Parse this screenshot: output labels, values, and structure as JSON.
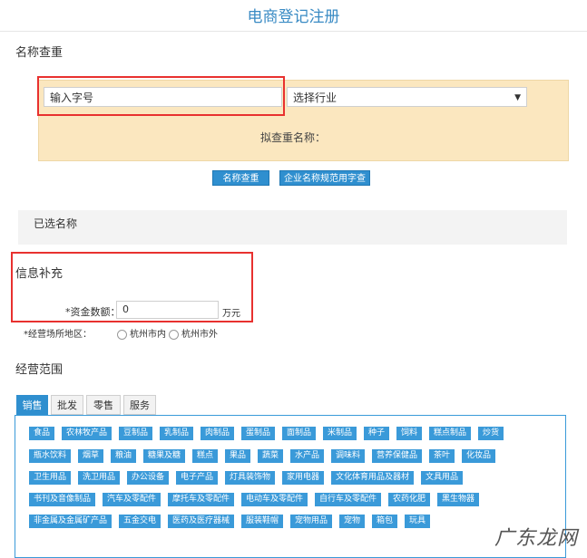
{
  "page": {
    "title": "电商登记注册"
  },
  "name_check": {
    "section_label": "名称查重",
    "input_placeholder": "输入字号",
    "industry_select": "选择行业",
    "proposed_name_label": "拟查重名称：",
    "check_button": "名称查重",
    "rules_button": "企业名称规范用字查询",
    "selected_label": "已选名称"
  },
  "info": {
    "section_label": "信息补充",
    "capital_label": "*资金数额：",
    "capital_value": "0",
    "capital_unit": "万元",
    "area_label": "*经营场所地区：",
    "area_options": [
      "杭州市内",
      "杭州市外"
    ]
  },
  "scope": {
    "section_label": "经营范围",
    "tabs": [
      "销售",
      "批发",
      "零售",
      "服务"
    ],
    "active_tab": 0,
    "rows": [
      [
        "食品",
        "农林牧产品",
        "豆制品",
        "乳制品",
        "肉制品",
        "蛋制品",
        "面制品",
        "米制品",
        "种子",
        "饲料",
        "糕点制品",
        "炒货"
      ],
      [
        "瓶水饮料",
        "烟草",
        "粮油",
        "糖果及糖",
        "糕点",
        "果品",
        "蔬菜",
        "水产品",
        "调味料",
        "营养保健品",
        "茶叶",
        "化妆品"
      ],
      [
        "卫生用品",
        "洗卫用品",
        "办公设备",
        "电子产品",
        "灯具装饰物",
        "家用电器",
        "文化体育用品及器材",
        "文具用品"
      ],
      [
        "书刊及音像制品",
        "汽车及零配件",
        "摩托车及零配件",
        "电动车及零配件",
        "自行车及零配件",
        "农药化肥",
        "黑生物器"
      ],
      [
        "非金属及金属矿产品",
        "五金交电",
        "医药及医疗器械",
        "服装鞋帽",
        "宠物用品",
        "宠物",
        "箱包",
        "玩具"
      ]
    ]
  },
  "watermark": "广东龙网"
}
